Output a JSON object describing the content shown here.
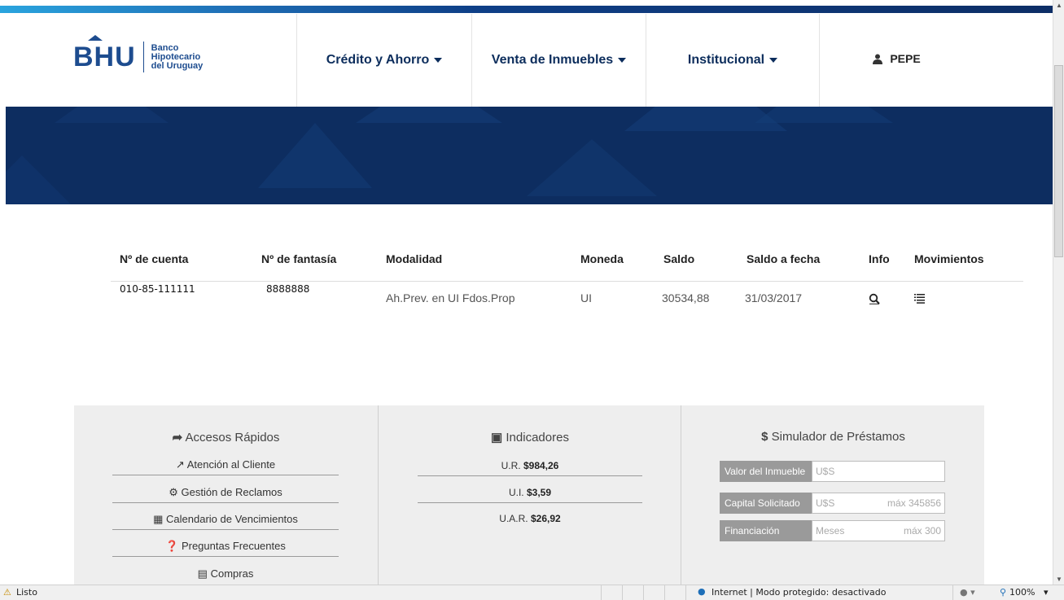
{
  "header": {
    "logo_mark": "BHU",
    "logo_line1": "Banco",
    "logo_line2": "Hipotecario",
    "logo_line3": "del Uruguay",
    "nav": [
      {
        "label": "Crédito y Ahorro"
      },
      {
        "label": "Venta de Inmuebles"
      },
      {
        "label": "Institucional"
      }
    ],
    "user_name": "PEPE"
  },
  "accounts": {
    "columns": [
      "Nº de cuenta",
      "Nº de fantasía",
      "Modalidad",
      "Moneda",
      "Saldo",
      "Saldo a fecha",
      "Info",
      "Movimientos"
    ],
    "rows": [
      {
        "cuenta": "010-85-111111",
        "fantasia": "8888888",
        "modalidad": "Ah.Prev. en UI Fdos.Prop",
        "moneda": "UI",
        "saldo": "30534,88",
        "fecha": "31/03/2017"
      }
    ]
  },
  "quick_access": {
    "title": "Accesos Rápidos",
    "links": [
      "Atención al Cliente",
      "Gestión de Reclamos",
      "Calendario de Vencimientos",
      "Preguntas Frecuentes",
      "Compras"
    ]
  },
  "indicators": {
    "title": "Indicadores",
    "items": [
      {
        "label": "U.R.",
        "value": "$984,26"
      },
      {
        "label": "U.I.",
        "value": "$3,59"
      },
      {
        "label": "U.A.R.",
        "value": "$26,92"
      }
    ]
  },
  "simulator": {
    "title": "Simulador de Préstamos",
    "rows": [
      {
        "label": "Valor del Inmueble",
        "placeholder": "U$S",
        "hint": ""
      },
      {
        "label": "Capital Solicitado",
        "placeholder": "U$S",
        "hint": "máx 345856"
      },
      {
        "label": "Financiación",
        "placeholder": "Meses",
        "hint": "máx 300"
      }
    ]
  },
  "statusbar": {
    "status": "Listo",
    "zone": "Internet | Modo protegido: desactivado",
    "zoom": "100%"
  },
  "colors": {
    "navy": "#0d2d60",
    "brand_blue": "#1d4c8f",
    "panel_bg": "#eeeeee"
  }
}
